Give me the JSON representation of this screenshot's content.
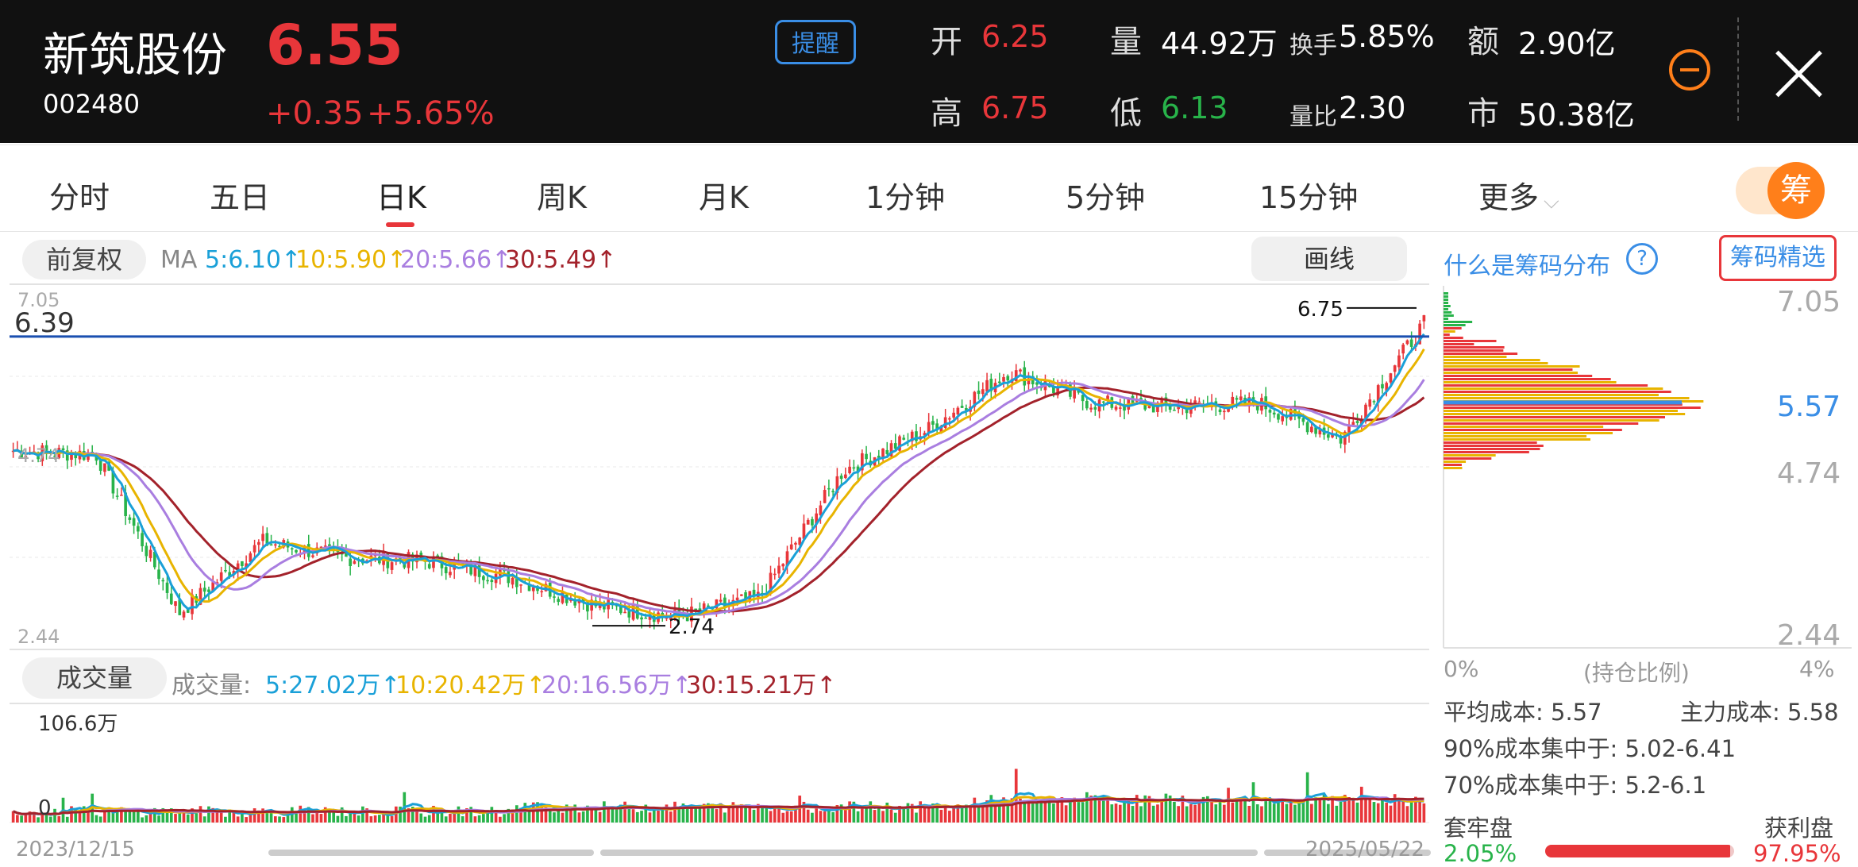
{
  "header": {
    "name": "新筑股份",
    "price": "6.55",
    "code": "002480",
    "change": "+0.35",
    "change_pct": "+5.65%",
    "remind_label": "提醒",
    "open_label": "开",
    "open_value": "6.25",
    "volume_label": "量",
    "volume_value": "44.92万",
    "turnover_label": "换手",
    "turnover_value": "5.85%",
    "amount_label": "额",
    "amount_value": "2.90亿",
    "high_label": "高",
    "high_value": "6.75",
    "low_label": "低",
    "low_value": "6.13",
    "volratio_label": "量比",
    "volratio_value": "2.30",
    "mcap_label": "市",
    "mcap_value": "50.38亿"
  },
  "tabs": [
    "分时",
    "五日",
    "日K",
    "周K",
    "月K",
    "1分钟",
    "5分钟",
    "15分钟",
    "更多"
  ],
  "active_tab": "日K",
  "toggle_label": "筹",
  "chart_header": {
    "adjust_label": "前复权",
    "ma_label": "MA",
    "ma5": "5:6.10↑",
    "ma10": "10:5.90↑",
    "ma20": "20:5.66↑",
    "ma30": "30:5.49↑",
    "draw_label": "画线"
  },
  "price_chart": {
    "y_top_label": "7.05",
    "crosshair_label": "6.39",
    "mid_label": "4.74",
    "y_bottom_label": "2.44",
    "max_annotation": "6.75",
    "min_annotation": "2.74",
    "ylim": [
      2.44,
      7.05
    ],
    "crosshair_value": 6.39,
    "max_value": 6.75,
    "min_value": 2.74
  },
  "volume_chart": {
    "title": "成交量",
    "prefix": "成交量:",
    "ma5": "5:27.02万↑",
    "ma10": "10:20.42万↑",
    "ma20": "20:16.56万↑",
    "ma30": "30:15.21万↑",
    "max_label": "106.6万",
    "zero_label": "0",
    "start_date": "2023/12/15",
    "end_date": "2025/05/22"
  },
  "chip_panel": {
    "title": "什么是筹码分布",
    "help_icon": "?",
    "select_label": "筹码精选",
    "y_top": "7.05",
    "y_avg": "5.57",
    "y_mid": "4.74",
    "y_bottom": "2.44",
    "x_min": "0%",
    "x_caption": "(持仓比例)",
    "x_max": "4%",
    "avg_cost": "平均成本: 5.57",
    "main_cost": "主力成本: 5.58",
    "conc90": "90%成本集中于: 5.02-6.41",
    "conc70": "70%成本集中于: 5.2-6.1",
    "trapped_label": "套牢盘",
    "profit_label": "获利盘",
    "trapped_pct": "2.05%",
    "profit_pct": "97.95%",
    "profit_ratio": 0.9795
  },
  "colors": {
    "up": "#e8363a",
    "down": "#28b34a",
    "ma5": "#1aa0d8",
    "ma10": "#e8b400",
    "ma20": "#a97ee0",
    "ma30": "#a3222b",
    "crosshair": "#1a4fb0",
    "accent_blue": "#3a8ee6",
    "orange": "#ff7f1a"
  },
  "chart_data": {
    "type": "candlestick",
    "ylim": [
      2.44,
      7.05
    ],
    "close_points": [
      [
        "2023/12/15",
        4.95
      ],
      [
        "2024/01",
        4.9
      ],
      [
        "2024/02-low",
        2.9
      ],
      [
        "2024/03",
        3.8
      ],
      [
        "2024/04",
        3.6
      ],
      [
        "2024/05",
        3.55
      ],
      [
        "2024/06",
        3.35
      ],
      [
        "2024/07",
        3.0
      ],
      [
        "2024/08",
        2.85
      ],
      [
        "2024/09",
        3.1
      ],
      [
        "2024/10",
        4.7
      ],
      [
        "2024/11",
        5.2
      ],
      [
        "2024/12",
        5.95
      ],
      [
        "2025/01",
        5.55
      ],
      [
        "2025/02",
        5.5
      ],
      [
        "2025/03",
        5.55
      ],
      [
        "2025/04",
        5.1
      ],
      [
        "2025/05/22",
        6.55
      ]
    ]
  }
}
